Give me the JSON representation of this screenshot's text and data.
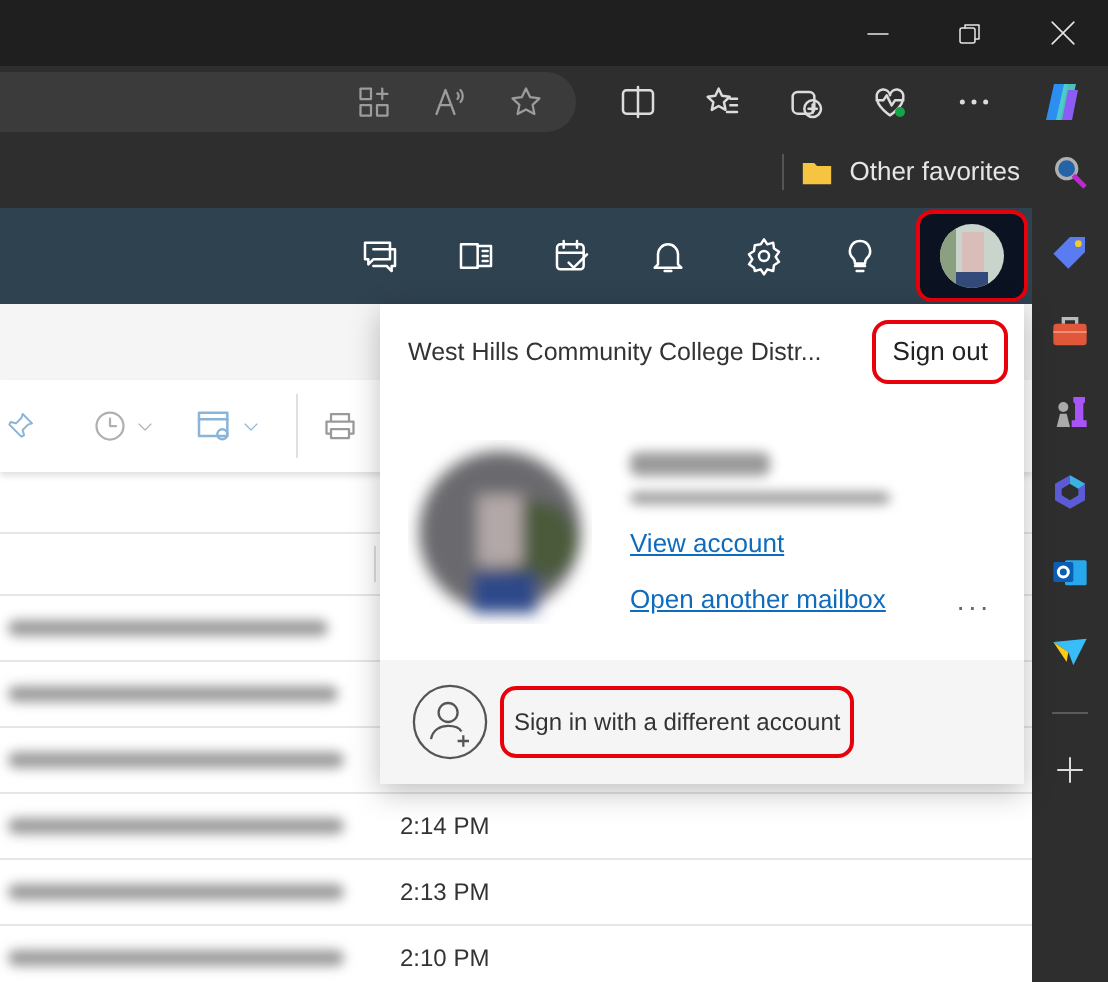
{
  "favorites_bar": {
    "folder": "Other favorites"
  },
  "account_button": {
    "highlighted": true
  },
  "account_menu": {
    "organization": "West Hills Community College Distr...",
    "sign_out": {
      "label": "Sign out",
      "highlighted": true
    },
    "links": [
      "View account",
      "Open another mailbox"
    ],
    "more": "...",
    "sign_in_other": {
      "label": "Sign in with a different account",
      "highlighted": true
    }
  },
  "mail_list": {
    "rows": [
      {
        "time": "2:14 PM"
      },
      {
        "time": "2:13 PM"
      },
      {
        "time": "2:10 PM"
      }
    ]
  }
}
